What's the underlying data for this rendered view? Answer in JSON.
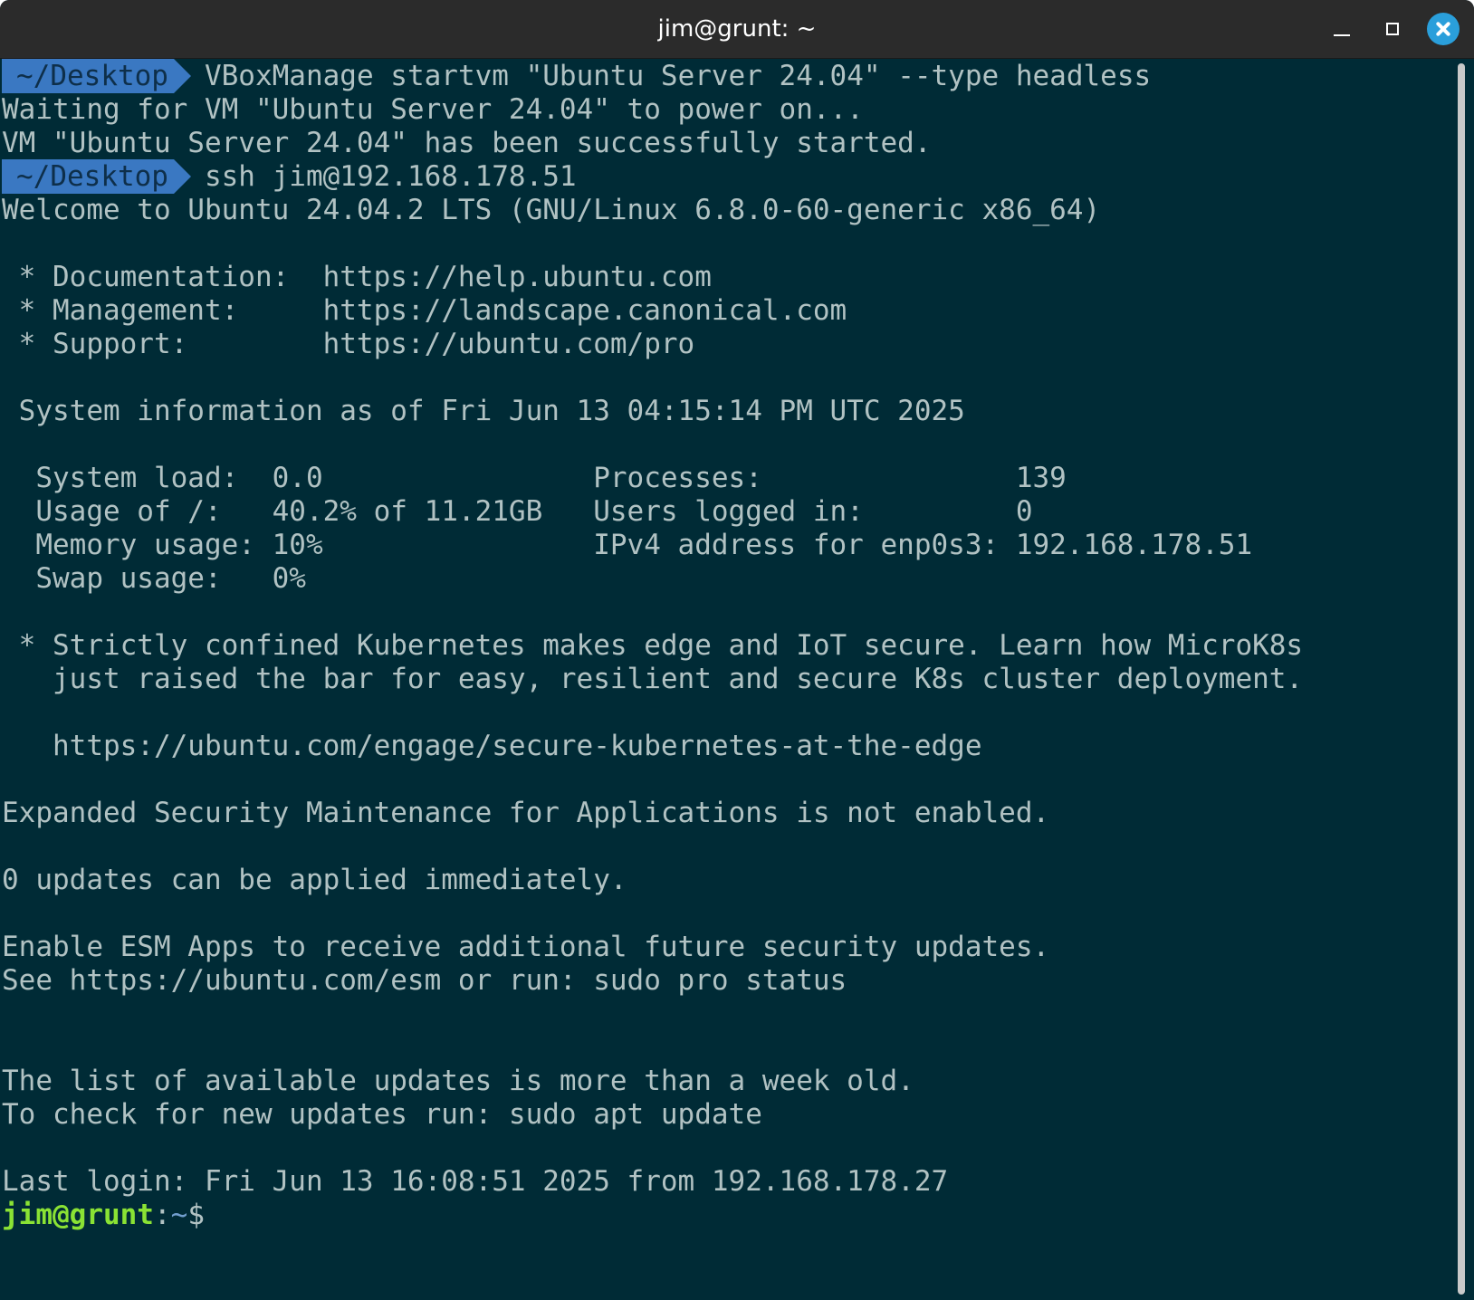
{
  "window": {
    "title": "jim@grunt: ~"
  },
  "terminal": {
    "prompts": [
      {
        "path": "~/Desktop",
        "command": "VBoxManage startvm \"Ubuntu Server 24.04\" --type headless"
      },
      {
        "path": "~/Desktop",
        "command": "ssh jim@192.168.178.51"
      }
    ],
    "output": {
      "waiting": "Waiting for VM \"Ubuntu Server 24.04\" to power on...",
      "started": "VM \"Ubuntu Server 24.04\" has been successfully started.",
      "welcome": "Welcome to Ubuntu 24.04.2 LTS (GNU/Linux 6.8.0-60-generic x86_64)",
      "documentation": " * Documentation:  https://help.ubuntu.com",
      "management": " * Management:     https://landscape.canonical.com",
      "support": " * Support:        https://ubuntu.com/pro",
      "sysinfo_header": " System information as of Fri Jun 13 04:15:14 PM UTC 2025",
      "sysinfo_1": "  System load:  0.0                Processes:               139",
      "sysinfo_2": "  Usage of /:   40.2% of 11.21GB   Users logged in:         0",
      "sysinfo_3": "  Memory usage: 10%                IPv4 address for enp0s3: 192.168.178.51",
      "sysinfo_4": "  Swap usage:   0%",
      "k8s_1": " * Strictly confined Kubernetes makes edge and IoT secure. Learn how MicroK8s",
      "k8s_2": "   just raised the bar for easy, resilient and secure K8s cluster deployment.",
      "k8s_url": "   https://ubuntu.com/engage/secure-kubernetes-at-the-edge",
      "esm": "Expanded Security Maintenance for Applications is not enabled.",
      "updates": "0 updates can be applied immediately.",
      "esm_enable": "Enable ESM Apps to receive additional future security updates.",
      "esm_see": "See https://ubuntu.com/esm or run: sudo pro status",
      "list_old": "The list of available updates is more than a week old.",
      "check_updates": "To check for new updates run: sudo apt update",
      "last_login": "Last login: Fri Jun 13 16:08:51 2025 from 192.168.178.27"
    },
    "shell_prompt": {
      "user_host": "jim@grunt",
      "separator": ":",
      "path": "~",
      "symbol": "$"
    }
  },
  "colors": {
    "background": "#002b36",
    "text": "#b1c2c3",
    "prompt_segment": "#3a78c2",
    "user_host": "#8ae234",
    "path": "#729fcf",
    "close_button": "#2a9fdb"
  }
}
